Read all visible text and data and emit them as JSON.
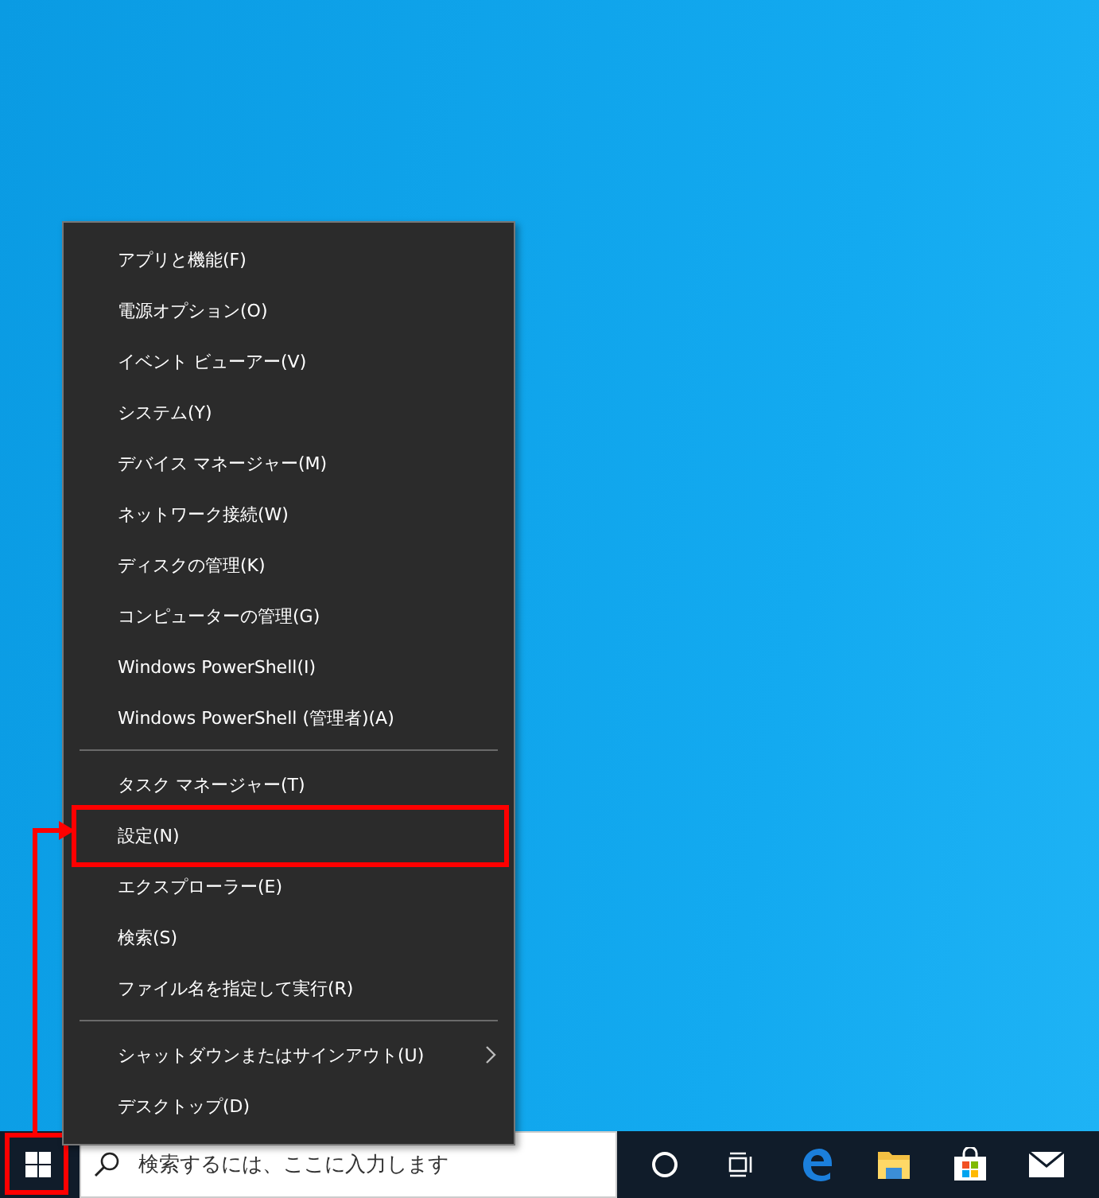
{
  "menu": {
    "groups": [
      {
        "items": [
          {
            "label": "アプリと機能(F)",
            "submenu": false,
            "highlighted": false
          },
          {
            "label": "電源オプション(O)",
            "submenu": false,
            "highlighted": false
          },
          {
            "label": "イベント ビューアー(V)",
            "submenu": false,
            "highlighted": false
          },
          {
            "label": "システム(Y)",
            "submenu": false,
            "highlighted": false
          },
          {
            "label": "デバイス マネージャー(M)",
            "submenu": false,
            "highlighted": false
          },
          {
            "label": "ネットワーク接続(W)",
            "submenu": false,
            "highlighted": false
          },
          {
            "label": "ディスクの管理(K)",
            "submenu": false,
            "highlighted": false
          },
          {
            "label": "コンピューターの管理(G)",
            "submenu": false,
            "highlighted": false
          },
          {
            "label": "Windows PowerShell(I)",
            "submenu": false,
            "highlighted": false
          },
          {
            "label": "Windows PowerShell (管理者)(A)",
            "submenu": false,
            "highlighted": false
          }
        ]
      },
      {
        "items": [
          {
            "label": "タスク マネージャー(T)",
            "submenu": false,
            "highlighted": false
          },
          {
            "label": "設定(N)",
            "submenu": false,
            "highlighted": true
          },
          {
            "label": "エクスプローラー(E)",
            "submenu": false,
            "highlighted": false
          },
          {
            "label": "検索(S)",
            "submenu": false,
            "highlighted": false
          },
          {
            "label": "ファイル名を指定して実行(R)",
            "submenu": false,
            "highlighted": false
          }
        ]
      },
      {
        "items": [
          {
            "label": "シャットダウンまたはサインアウト(U)",
            "submenu": true,
            "highlighted": false
          },
          {
            "label": "デスクトップ(D)",
            "submenu": false,
            "highlighted": false
          }
        ]
      }
    ]
  },
  "taskbar": {
    "start_highlighted": true,
    "search": {
      "placeholder": "検索するには、ここに入力します"
    }
  }
}
